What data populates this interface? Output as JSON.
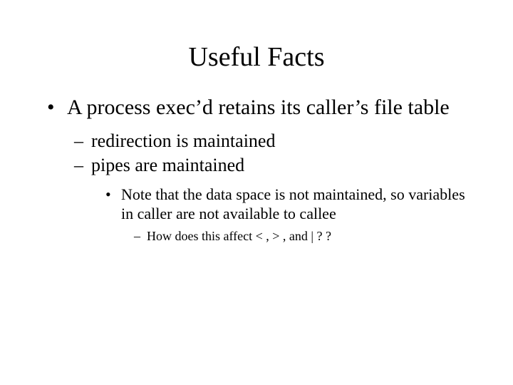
{
  "title": "Useful Facts",
  "bullets": {
    "b1": "A process exec’d retains its caller’s file table",
    "b1_1": "redirection is maintained",
    "b1_2": "pipes are maintained",
    "b1_2_1": "Note that the data space is not maintained, so variables in caller are not available to callee",
    "b1_2_1_1": "How does this affect  < ,  > , and |  ? ?"
  }
}
